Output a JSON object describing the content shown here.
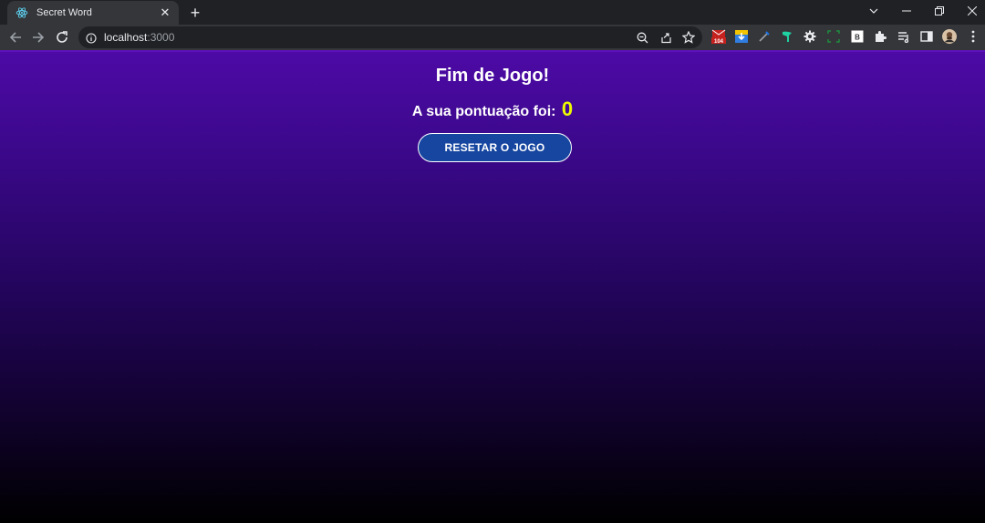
{
  "browser": {
    "tab": {
      "title": "Secret Word",
      "favicon": "react-icon"
    },
    "address": {
      "host": "localhost",
      "port": ":3000"
    },
    "extensions": {
      "badge_count": "104",
      "bitwarden_letter": "B"
    }
  },
  "game": {
    "title": "Fim de Jogo!",
    "score_label": "A sua pontuação foi:",
    "score_value": "0",
    "reset_label": "RESETAR O JOGO"
  },
  "colors": {
    "gradient_top": "#4d0aa6",
    "gradient_bottom": "#000000",
    "score_color": "#ecfa00",
    "button_bg": "#1646a0"
  }
}
